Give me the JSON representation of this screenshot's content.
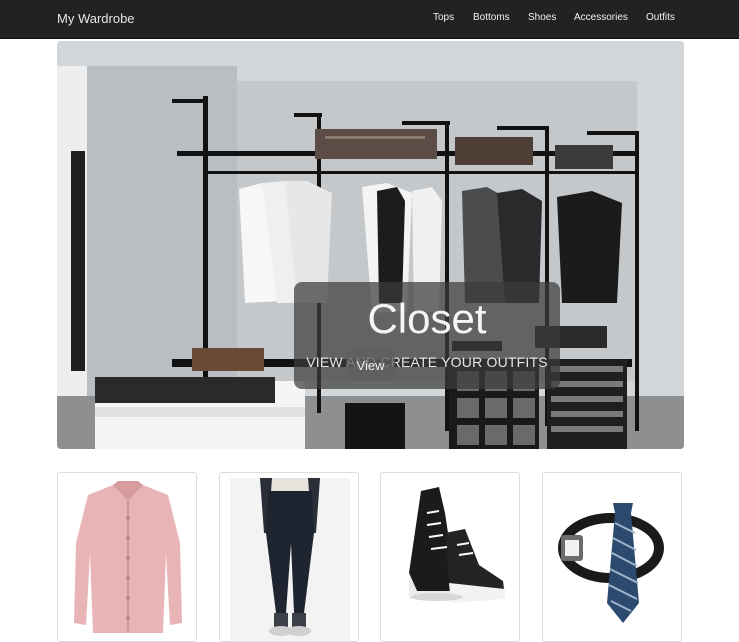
{
  "navbar": {
    "brand": "My Wardrobe",
    "links": [
      {
        "label": "Tops"
      },
      {
        "label": "Bottoms"
      },
      {
        "label": "Shoes"
      },
      {
        "label": "Accessories"
      },
      {
        "label": "Outfits"
      }
    ]
  },
  "hero": {
    "title": "Closet",
    "subtitle": "VIEW AND CREATE YOUR OUTFITS",
    "button_label": "View"
  },
  "cards": [
    {
      "icon": "pink-shirt-icon"
    },
    {
      "icon": "jeans-icon"
    },
    {
      "icon": "sneakers-icon"
    },
    {
      "icon": "belt-tie-icon"
    }
  ]
}
